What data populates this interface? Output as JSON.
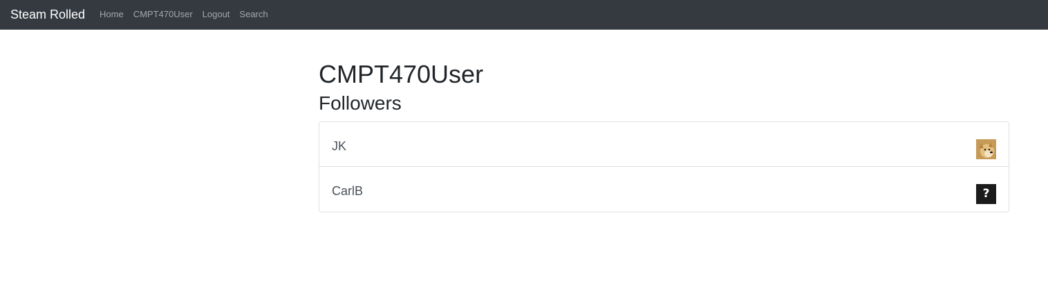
{
  "navbar": {
    "brand": "Steam Rolled",
    "links": [
      "Home",
      "CMPT470User",
      "Logout",
      "Search"
    ]
  },
  "profile": {
    "username": "CMPT470User",
    "section_title": "Followers"
  },
  "followers": [
    {
      "name": "JK",
      "avatar": "doge-avatar"
    },
    {
      "name": "CarlB",
      "avatar": "question-mark-avatar",
      "avatar_text": "?"
    }
  ],
  "colors": {
    "navbar_bg": "#343a40",
    "brand": "#ffffff",
    "nav_link": "#9a9da0",
    "list_border": "#dfdfdf"
  }
}
